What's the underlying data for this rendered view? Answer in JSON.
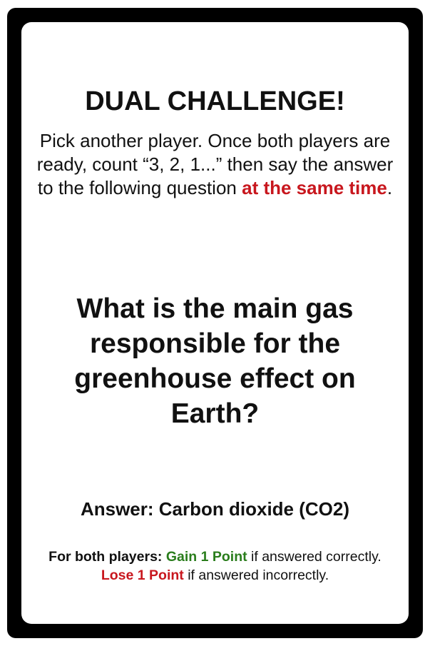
{
  "card": {
    "title": "DUAL CHALLENGE!",
    "instructions": {
      "before": "Pick another player. Once both players are ready, count “3, 2, 1...” then say the answer to the following question ",
      "highlight": "at the same time",
      "after": "."
    },
    "question": "What is the main gas responsible for the greenhouse effect on Earth?",
    "answer": "Answer: Carbon dioxide (CO2)",
    "rules": {
      "lead": "For both players:",
      "gain": "Gain 1 Point",
      "gain_tail": "if answered correctly.",
      "lose": "Lose 1 Point",
      "lose_tail": "if answered incorrectly."
    }
  },
  "colors": {
    "frame": "#000000",
    "face": "#ffffff",
    "highlight_red": "#c8171e",
    "gain_green": "#2a7d1c"
  }
}
